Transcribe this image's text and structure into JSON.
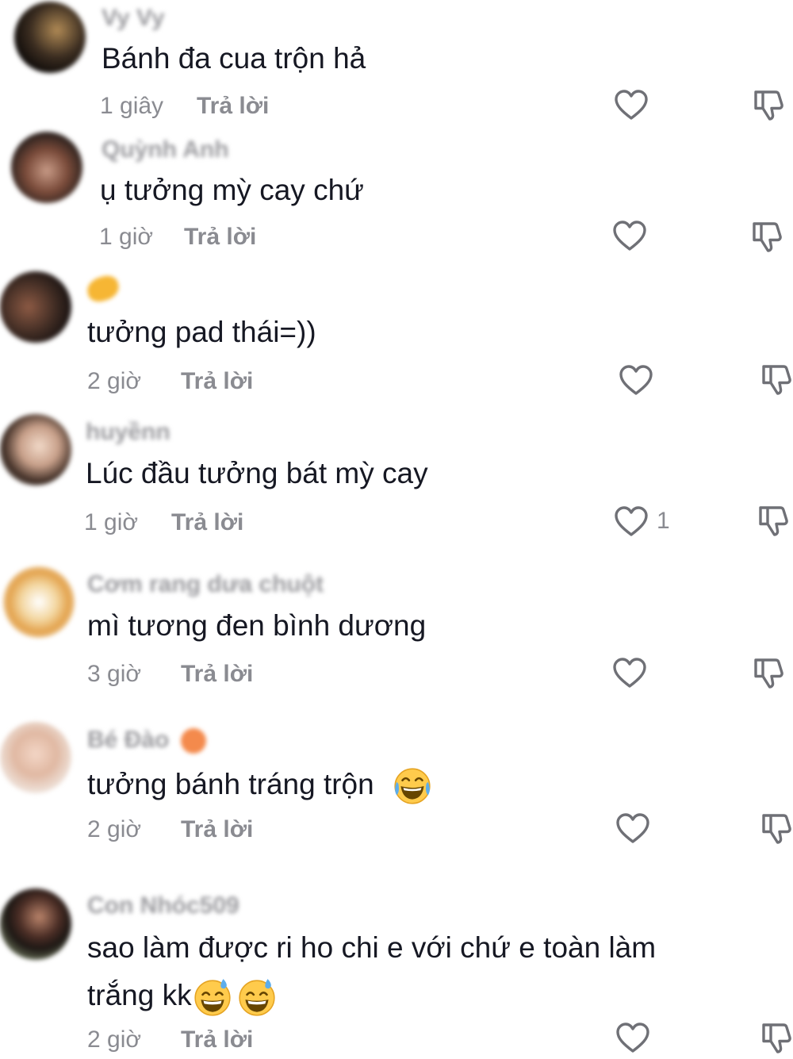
{
  "comments": [
    {
      "username": "Vy Vy",
      "text": "Bánh đa cua trộn hả",
      "time": "1 giây",
      "reply": "Trả lời"
    },
    {
      "username": "Quỳnh Anh",
      "text": "ụ tưởng mỳ cay chứ",
      "time": "1 giờ",
      "reply": "Trả lời"
    },
    {
      "username": "",
      "text": "tưởng pad thái=))",
      "time": "2 giờ",
      "reply": "Trả lời"
    },
    {
      "username": "huyềnn",
      "text": "Lúc đầu tưởng bát mỳ cay",
      "time": "1 giờ",
      "reply": "Trả lời",
      "likes": "1"
    },
    {
      "username": "Cơm rang dưa chuột",
      "text": "mì tương đen bình dương",
      "time": "3 giờ",
      "reply": "Trả lời"
    },
    {
      "username": "Bé Đào",
      "text": "tưởng bánh tráng trộn",
      "time": "2 giờ",
      "reply": "Trả lời"
    },
    {
      "username": "Con Nhóc509",
      "text": "sao làm được ri ho chi e với chứ e toàn làm",
      "text2": "trắng kk",
      "time": "2 giờ",
      "reply": "Trả lời"
    }
  ],
  "colors": {
    "primary_text": "#161823",
    "secondary_text": "#8a8b91",
    "icon": "#6f7076"
  },
  "icons": {
    "like": "heart-outline-icon",
    "dislike": "thumbs-down-outline-icon",
    "laugh": "face-with-tears-of-joy-emoji",
    "sweat": "grinning-face-with-sweat-emoji"
  }
}
